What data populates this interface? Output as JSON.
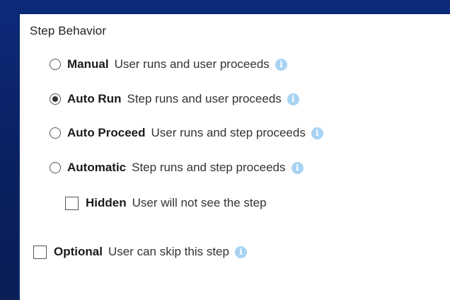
{
  "section_title": "Step Behavior",
  "options": [
    {
      "title": "Manual",
      "description": "User runs and user proceeds",
      "selected": false,
      "icon": "info-icon"
    },
    {
      "title": "Auto Run",
      "description": "Step runs and user proceeds",
      "selected": true,
      "icon": "info-icon"
    },
    {
      "title": "Auto Proceed",
      "description": "User runs and step proceeds",
      "selected": false,
      "icon": "info-icon"
    },
    {
      "title": "Automatic",
      "description": "Step runs and step proceeds",
      "selected": false,
      "icon": "info-icon"
    }
  ],
  "hidden": {
    "title": "Hidden",
    "description": "User will not see the step",
    "checked": false
  },
  "optional": {
    "title": "Optional",
    "description": "User can skip this step",
    "checked": false,
    "icon": "info-icon"
  },
  "colors": {
    "background": "#0a1f5f",
    "panel": "#ffffff",
    "info_icon": "#a8d3f3"
  }
}
